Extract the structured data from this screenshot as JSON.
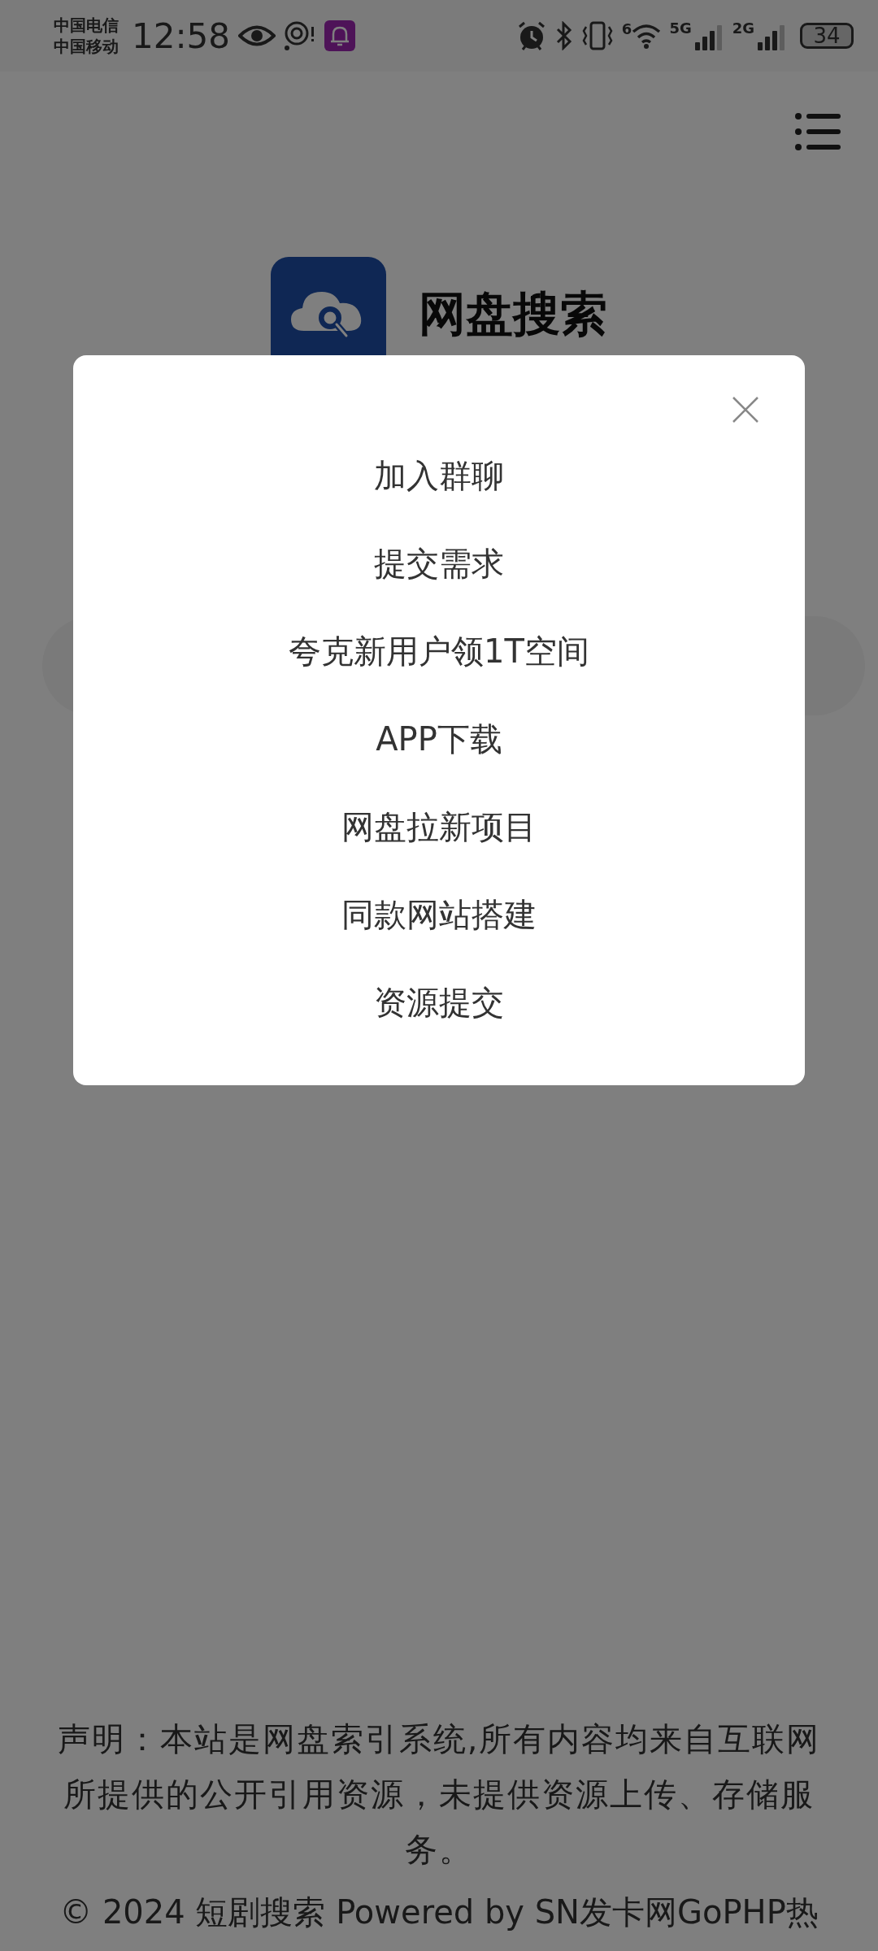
{
  "status_bar": {
    "carrier_1": "中国电信",
    "carrier_2": "中国移动",
    "time": "12:58",
    "wifi_label": "6",
    "signal_1_label": "5G",
    "signal_2_label": "2G",
    "battery": "34"
  },
  "header": {
    "app_name": "网盘搜索"
  },
  "modal": {
    "items": [
      "加入群聊",
      "提交需求",
      "夸克新用户领1T空间",
      "APP下载",
      "网盘拉新项目",
      "同款网站搭建",
      "资源提交"
    ]
  },
  "footer": {
    "disclaimer": "声明：本站是网盘索引系统,所有内容均来自互联网所提供的公开引用资源，未提供资源上传、存储服务。",
    "copyright": "© 2024 短剧搜索 Powered by SN发卡网GoPHP热"
  }
}
